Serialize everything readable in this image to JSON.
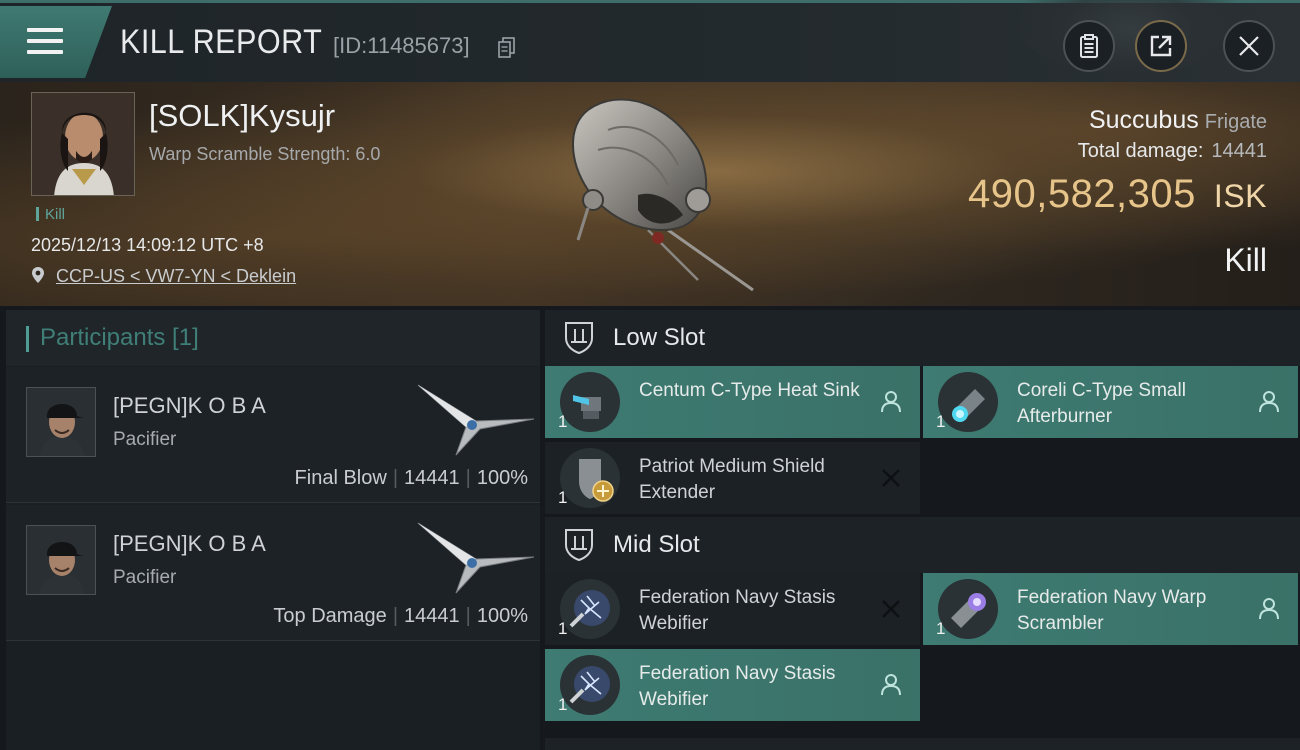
{
  "header": {
    "title": "KILL REPORT",
    "report_id": "[ID:11485673]"
  },
  "victim": {
    "name": "[SOLK]Kysujr",
    "warp_scramble": "Warp Scramble Strength: 6.0",
    "kill_tag": "Kill",
    "time": "2025/12/13 14:09:12 UTC +8",
    "location": "CCP-US < VW7-YN < Deklein",
    "ship_name": "Succubus",
    "ship_class": "Frigate",
    "total_damage_label": "Total damage:",
    "total_damage": "14441",
    "isk_value": "490,582,305",
    "isk_unit": "ISK",
    "result": "Kill"
  },
  "participants": {
    "title": "Participants [1]",
    "rows": [
      {
        "name": "[PEGN]K O B A",
        "ship": "Pacifier",
        "role": "Final Blow",
        "damage": "14441",
        "percent": "100%"
      },
      {
        "name": "[PEGN]K O B A",
        "ship": "Pacifier",
        "role": "Top Damage",
        "damage": "14441",
        "percent": "100%"
      }
    ]
  },
  "slots": {
    "low": {
      "title": "Low Slot",
      "modules": [
        {
          "name": "Centum C-Type Heat Sink",
          "qty": "1",
          "state": "dropped"
        },
        {
          "name": "Coreli C-Type Small Afterburner",
          "qty": "1",
          "state": "dropped"
        },
        {
          "name": "Patriot Medium Shield Extender",
          "qty": "1",
          "state": "destroyed"
        }
      ]
    },
    "mid": {
      "title": "Mid Slot",
      "modules": [
        {
          "name": "Federation Navy Stasis Webifier",
          "qty": "1",
          "state": "destroyed"
        },
        {
          "name": "Federation Navy Warp Scrambler",
          "qty": "1",
          "state": "dropped"
        },
        {
          "name": "Federation Navy Stasis Webifier",
          "qty": "1",
          "state": "dropped"
        }
      ]
    }
  },
  "icons": {
    "menu": "menu-icon",
    "copy": "copy-icon",
    "clipboard": "clipboard-icon",
    "share": "share-icon",
    "close": "close-icon",
    "location": "pin-icon",
    "slot": "slot-shield-icon",
    "dropped": "person-icon",
    "destroyed": "x-icon"
  },
  "colors": {
    "accent_teal": "#3e7b72",
    "isk_gold": "#e7c58a",
    "kill_green": "#5fa59b"
  }
}
